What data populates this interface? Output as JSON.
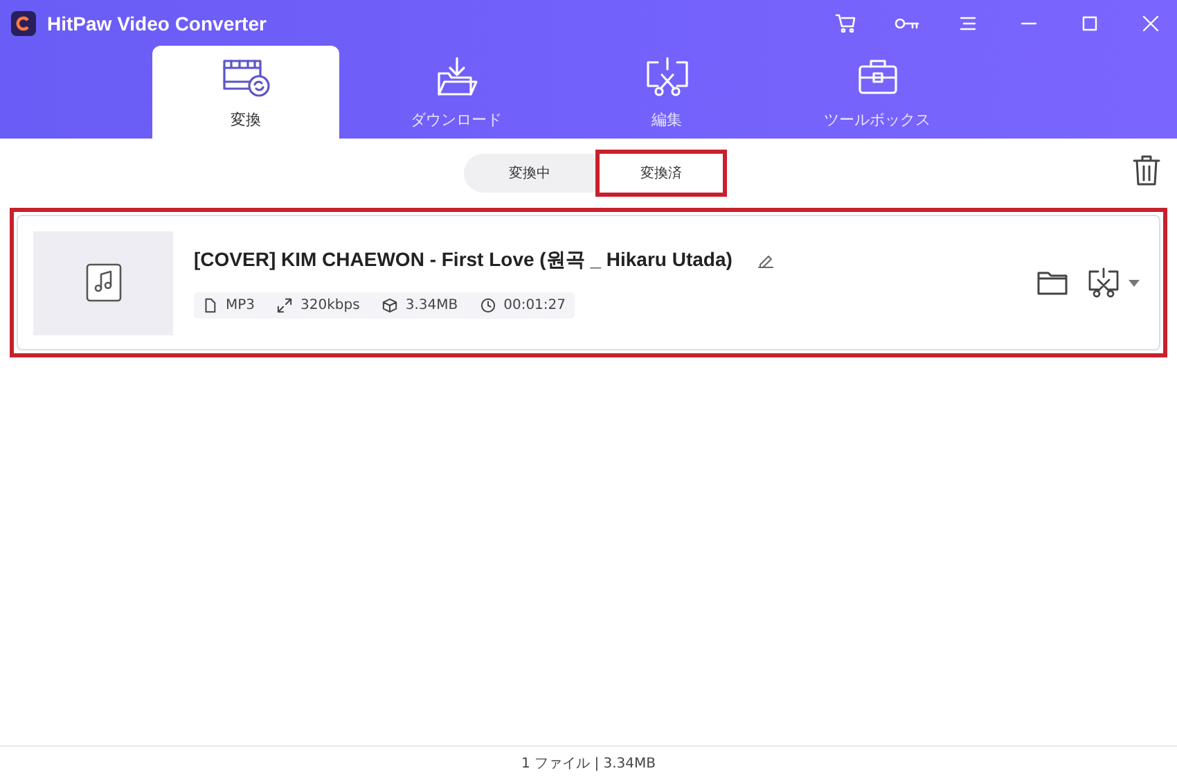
{
  "window": {
    "title": "HitPaw Video Converter"
  },
  "tabs": [
    {
      "label": "変換",
      "selected": true,
      "kind": "convert"
    },
    {
      "label": "ダウンロード",
      "selected": false,
      "kind": "download"
    },
    {
      "label": "編集",
      "selected": false,
      "kind": "edit"
    },
    {
      "label": "ツールボックス",
      "selected": false,
      "kind": "toolbox"
    }
  ],
  "subtabs": [
    {
      "label": "変換中",
      "selected": false,
      "highlighted": false
    },
    {
      "label": "変換済",
      "selected": true,
      "highlighted": true
    }
  ],
  "files": [
    {
      "title": "[COVER] KIM CHAEWON - First Love (원곡 _ Hikaru Utada)",
      "highlighted": true,
      "meta": [
        {
          "kind": "format",
          "text": "MP3"
        },
        {
          "kind": "bitrate",
          "text": "320kbps"
        },
        {
          "kind": "size",
          "text": "3.34MB"
        },
        {
          "kind": "duration",
          "text": "00:01:27"
        }
      ]
    }
  ],
  "status_bar": "1 ファイル | 3.34MB"
}
